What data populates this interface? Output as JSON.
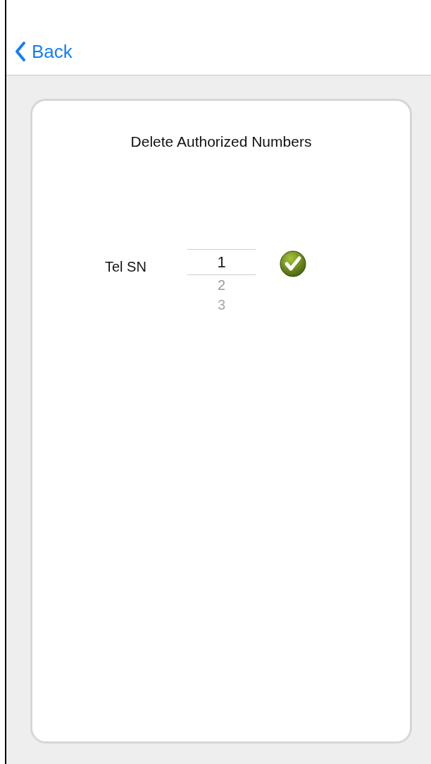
{
  "nav": {
    "back_label": "Back"
  },
  "card": {
    "title": "Delete Authorized Numbers",
    "field": {
      "label": "Tel SN",
      "options": [
        {
          "value": "1",
          "selected": true
        },
        {
          "value": "2",
          "selected": false
        },
        {
          "value": "3",
          "selected": false
        }
      ]
    }
  }
}
